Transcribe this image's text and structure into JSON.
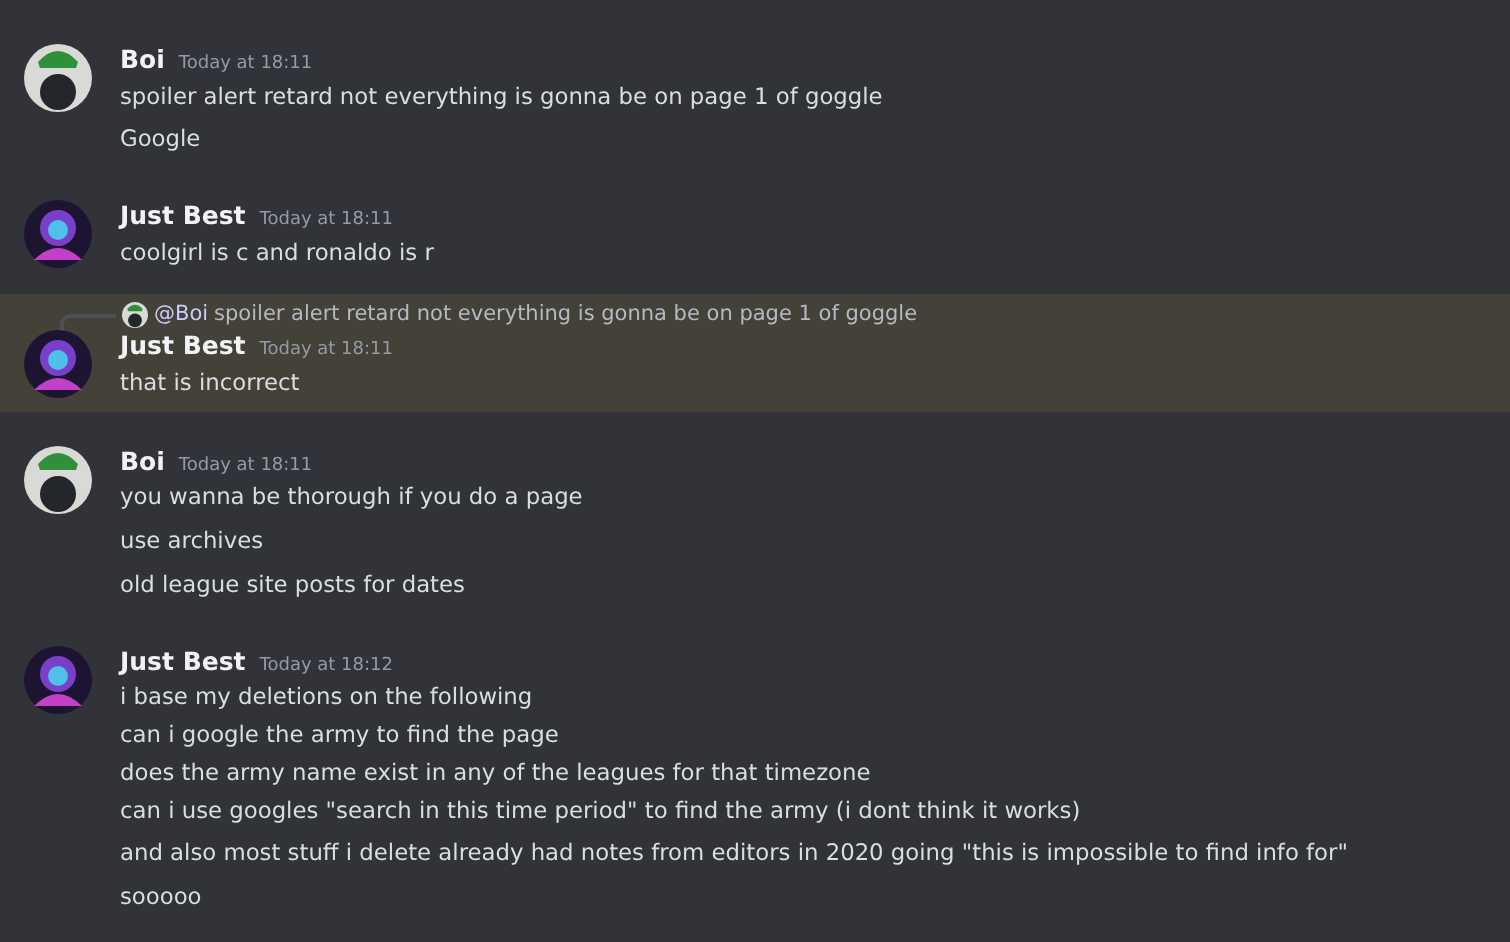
{
  "groups": [
    {
      "author": "Boi",
      "timestamp": "Today at 18:11",
      "color": "#d9d9d6",
      "highlighted": false,
      "messages": [
        {
          "lines": [
            "spoiler alert retard not everything is gonna be on page 1 of goggle"
          ]
        },
        {
          "lines": [
            "Google"
          ]
        }
      ]
    },
    {
      "author": "Just Best",
      "timestamp": "Today at 18:11",
      "color": "#1c1430",
      "highlighted": false,
      "messages": [
        {
          "lines": [
            "coolgirl is c and ronaldo is r"
          ]
        }
      ]
    },
    {
      "author": "Just Best",
      "timestamp": "Today at 18:11",
      "color": "#1c1430",
      "highlighted": true,
      "reply": {
        "mention": "@Boi",
        "text": "spoiler alert retard not everything is gonna be on page 1 of goggle",
        "color": "#d9d9d6"
      },
      "messages": [
        {
          "lines": [
            "that is incorrect"
          ]
        }
      ]
    },
    {
      "author": "Boi",
      "timestamp": "Today at 18:11",
      "color": "#d9d9d6",
      "highlighted": false,
      "messages": [
        {
          "lines": [
            "you wanna be thorough if you do a page"
          ]
        },
        {
          "lines": [
            "use archives"
          ]
        },
        {
          "lines": [
            "old league site posts for dates"
          ]
        }
      ]
    },
    {
      "author": "Just Best",
      "timestamp": "Today at 18:12",
      "color": "#1c1430",
      "highlighted": false,
      "messages": [
        {
          "lines": [
            "i base my deletions on the following",
            "can i google the army to find the page",
            "does the army name exist in any of the leagues for that timezone",
            "can i use googles \"search in this time period\" to find the army (i dont think it works)"
          ]
        },
        {
          "lines": [
            "and also most stuff i delete already had notes from editors in 2020 going \"this is impossible to find info for\""
          ]
        },
        {
          "lines": [
            "sooooo"
          ]
        }
      ]
    }
  ]
}
